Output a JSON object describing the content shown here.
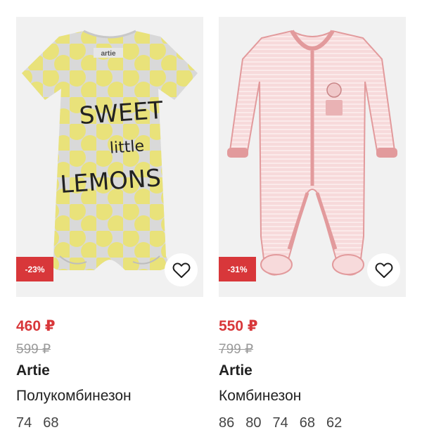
{
  "products": [
    {
      "discount": "-23%",
      "price": "460 ₽",
      "old_price": "599 ₽",
      "brand": "Artie",
      "name": "Полукомбинезон",
      "sizes": [
        "74",
        "68"
      ],
      "print_text": [
        "SWEET",
        "little",
        "LEMONS"
      ],
      "label_text": "artie",
      "colors": {
        "fabric": "#d9d9d9",
        "dots": "#e9e27a"
      }
    },
    {
      "discount": "-31%",
      "price": "550 ₽",
      "old_price": "799 ₽",
      "brand": "Artie",
      "name": "Комбинезон",
      "sizes": [
        "86",
        "80",
        "74",
        "68",
        "62"
      ],
      "colors": {
        "fabric": "#f6d5d6",
        "trim": "#e29a9c"
      }
    }
  ],
  "colors": {
    "accent": "#d8373a",
    "muted": "#9a9a9a"
  },
  "icons": {
    "favorite": "heart-outline-icon"
  }
}
